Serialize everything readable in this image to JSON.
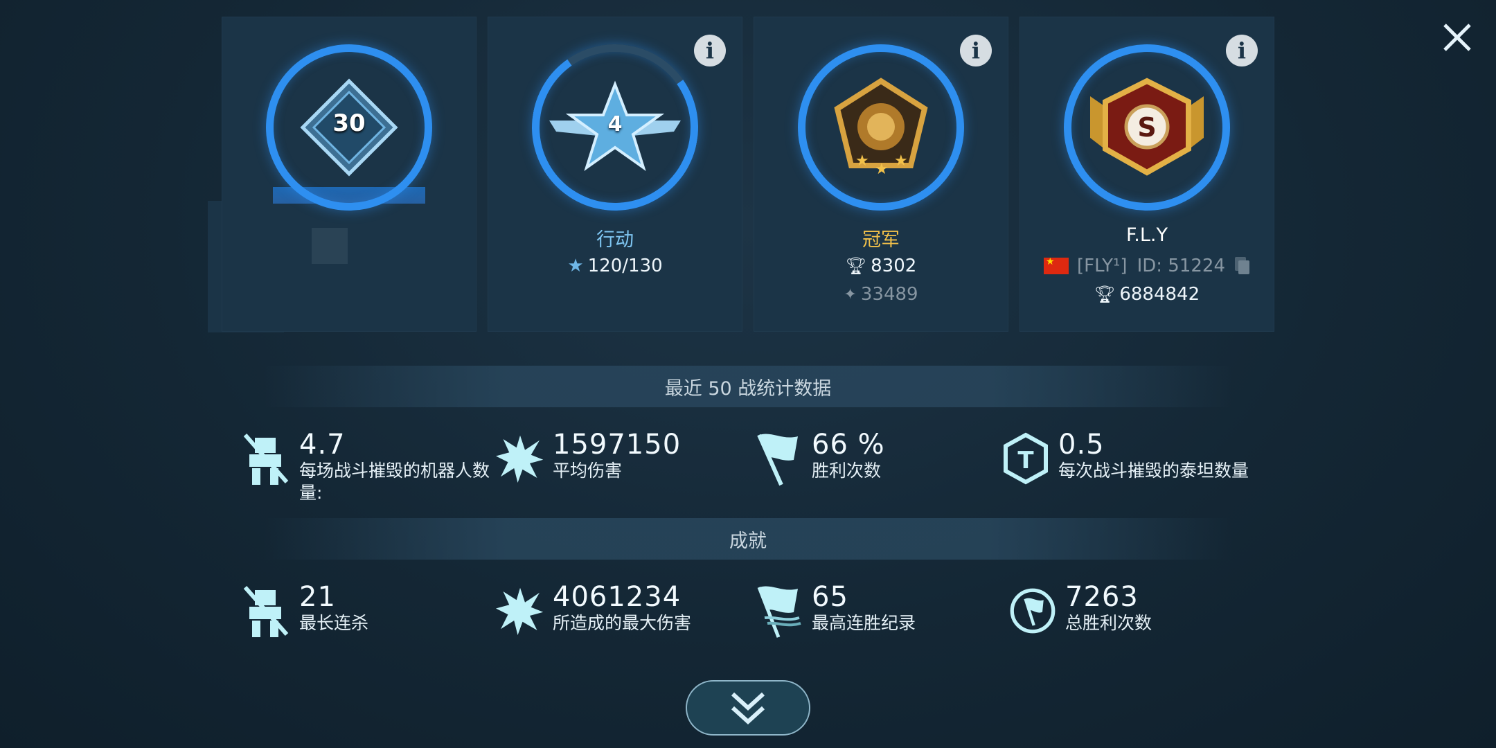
{
  "cards": {
    "level": {
      "value": "30"
    },
    "operation": {
      "rank": "4",
      "title": "行动",
      "progress": "120/130",
      "progress_fraction": 0.923
    },
    "league": {
      "title": "冠军",
      "trophies": "8302",
      "secondary": "33489"
    },
    "player": {
      "name": "F.L.Y",
      "clan": "[FLY¹]",
      "id": "ID: 51224",
      "trophies": "6884842",
      "rank_letter": "S"
    }
  },
  "recent_stats": {
    "header": "最近 50 战统计数据",
    "items": [
      {
        "value": "4.7",
        "label": "每场战斗摧毁的机器人数量:",
        "icon": "robot-destroyed-icon"
      },
      {
        "value": "1597150",
        "label": "平均伤害",
        "icon": "explosion-icon"
      },
      {
        "value": "66 %",
        "label": "胜利次数",
        "icon": "flag-icon"
      },
      {
        "value": "0.5",
        "label": "每次战斗摧毁的泰坦数量",
        "icon": "titan-icon"
      }
    ]
  },
  "achievements": {
    "header": "成就",
    "items": [
      {
        "value": "21",
        "label": "最长连杀",
        "icon": "robot-destroyed-icon"
      },
      {
        "value": "4061234",
        "label": "所造成的最大伤害",
        "icon": "explosion-icon"
      },
      {
        "value": "65",
        "label": "最高连胜纪录",
        "icon": "triple-flag-icon"
      },
      {
        "value": "7263",
        "label": "总胜利次数",
        "icon": "flag-circle-icon"
      }
    ]
  },
  "info_label": "i",
  "colors": {
    "ring": "#2e8ff0",
    "gold": "#f2c14a",
    "accent_blue": "#7fc6f2",
    "background": "#142735"
  }
}
